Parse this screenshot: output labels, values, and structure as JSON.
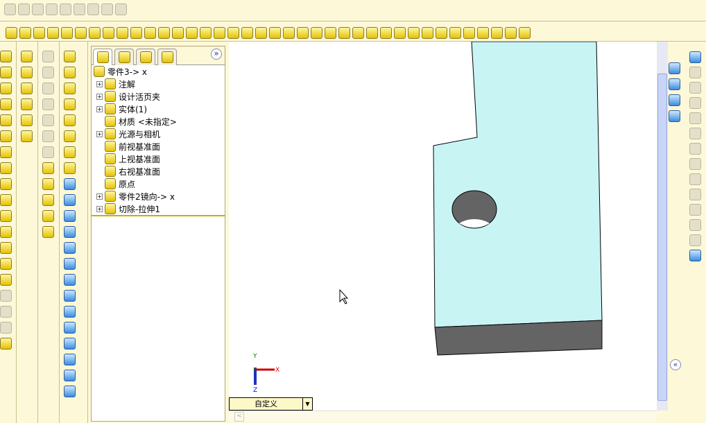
{
  "toolbar_top": {
    "icons": [
      "new-icon",
      "open-icon",
      "save-icon",
      "print-icon",
      "undo-icon",
      "redo-icon",
      "options-icon",
      "rebuild-icon",
      "user-icon"
    ]
  },
  "toolbar_main": {
    "icons": [
      "view-orient-icon",
      "dimension-icon",
      "smart-icon",
      "sketch-icon",
      "extrude-icon",
      "revolve-icon",
      "sweep-icon",
      "loft-icon",
      "fillet-icon",
      "chamfer-icon",
      "shell-icon",
      "rib-icon",
      "draft-icon",
      "hole-icon",
      "scale-icon",
      "dome-icon",
      "pattern-icon",
      "mirror-icon",
      "curve-icon",
      "surface-icon",
      "plane-icon",
      "axis-icon",
      "point-icon",
      "move-icon",
      "combine-icon",
      "split-icon",
      "intersect-icon",
      "section-icon",
      "measure-icon",
      "mass-icon",
      "hide-icon",
      "show-icon",
      "zoom-icon",
      "rotate-icon",
      "pan-icon",
      "shade-icon",
      "wireframe-icon",
      "more-icon"
    ],
    "overflow": "»"
  },
  "feature_tree": {
    "tabs": [
      "feature-manager-tab",
      "property-manager-tab",
      "configuration-manager-tab",
      "display-manager-tab"
    ],
    "expand": "»",
    "root": "零件3-> x",
    "items": [
      {
        "label": "注解",
        "icon": "annotation-folder-icon",
        "expandable": true
      },
      {
        "label": "设计活页夹",
        "icon": "design-binder-icon",
        "expandable": true
      },
      {
        "label": "实体(1)",
        "icon": "solid-bodies-icon",
        "expandable": true
      },
      {
        "label": "材质 <未指定>",
        "icon": "material-icon",
        "expandable": false
      },
      {
        "label": "光源与相机",
        "icon": "lights-cameras-icon",
        "expandable": true
      },
      {
        "label": "前视基准面",
        "icon": "plane-icon",
        "expandable": false
      },
      {
        "label": "上视基准面",
        "icon": "plane-icon",
        "expandable": false
      },
      {
        "label": "右视基准面",
        "icon": "plane-icon",
        "expandable": false
      },
      {
        "label": "原点",
        "icon": "origin-icon",
        "expandable": false
      },
      {
        "label": "零件2镜向-> x",
        "icon": "part-icon",
        "expandable": true
      },
      {
        "label": "切除-拉伸1",
        "icon": "cut-extrude-icon",
        "expandable": true
      }
    ]
  },
  "view": {
    "view_selector": "自定义",
    "triad": {
      "x": "X",
      "y": "Y",
      "z": "Z"
    },
    "face_color": "#c8f4f4",
    "side_color": "#646464"
  },
  "right_panel": {
    "collapse": "«"
  }
}
